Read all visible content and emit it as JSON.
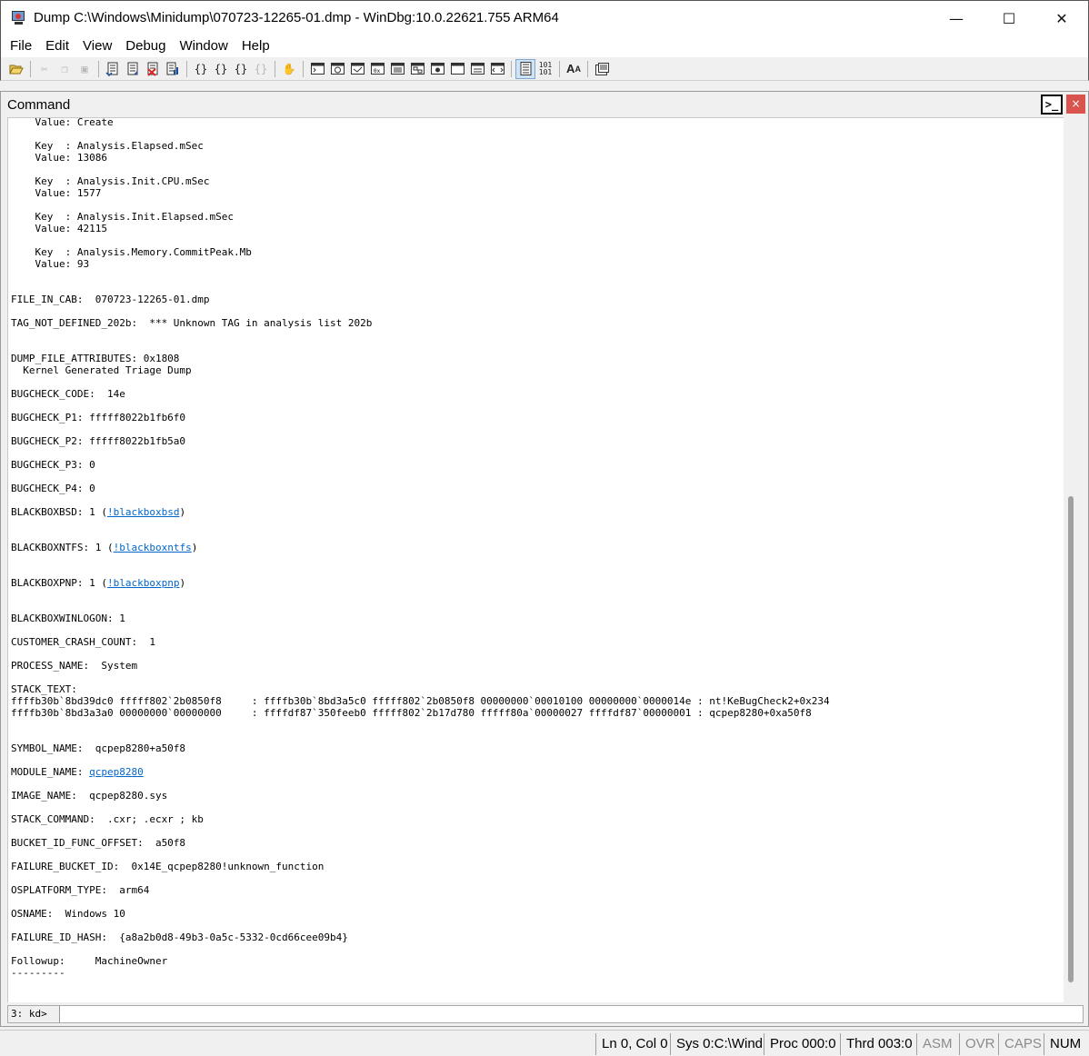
{
  "window": {
    "title": "Dump C:\\Windows\\Minidump\\070723-12265-01.dmp - WinDbg:10.0.22621.755 ARM64",
    "minimize": "—",
    "maximize": "☐",
    "close": "✕"
  },
  "menu": {
    "items": [
      "File",
      "Edit",
      "View",
      "Debug",
      "Window",
      "Help"
    ]
  },
  "toolbar": {
    "icons": [
      "open-icon",
      "cut-icon",
      "copy-icon",
      "paste-icon",
      "go-icon",
      "restart-icon",
      "stop-debugging-icon",
      "break-icon",
      "step-into-icon",
      "step-over-icon",
      "step-out-icon",
      "run-to-cursor-icon",
      "insert-breakpoint-icon",
      "command-icon",
      "watch-icon",
      "locals-icon",
      "registers-icon",
      "memory-icon",
      "call-stack-icon",
      "disassembly-icon",
      "scratch-pad-icon",
      "processes-icon",
      "source-mode-icon",
      "hex-icon",
      "font-icon",
      "options-icon"
    ]
  },
  "command_window": {
    "title": "Command",
    "close_glyph": "×",
    "console_glyph": ">_",
    "output": {
      "l1": "    Value: Create",
      "l2": "",
      "l3": "    Key  : Analysis.Elapsed.mSec",
      "l4": "    Value: 13086",
      "l5": "",
      "l6": "    Key  : Analysis.Init.CPU.mSec",
      "l7": "    Value: 1577",
      "l8": "",
      "l9": "    Key  : Analysis.Init.Elapsed.mSec",
      "l10": "    Value: 42115",
      "l11": "",
      "l12": "    Key  : Analysis.Memory.CommitPeak.Mb",
      "l13": "    Value: 93",
      "l14": "",
      "l15": "",
      "l16": "FILE_IN_CAB:  070723-12265-01.dmp",
      "l17": "",
      "l18": "TAG_NOT_DEFINED_202b:  *** Unknown TAG in analysis list 202b",
      "l19": "",
      "l20": "",
      "l21": "DUMP_FILE_ATTRIBUTES: 0x1808",
      "l22": "  Kernel Generated Triage Dump",
      "l23": "",
      "l24": "BUGCHECK_CODE:  14e",
      "l25": "",
      "l26": "BUGCHECK_P1: fffff8022b1fb6f0",
      "l27": "",
      "l28": "BUGCHECK_P2: fffff8022b1fb5a0",
      "l29": "",
      "l30": "BUGCHECK_P3: 0",
      "l31": "",
      "l32": "BUGCHECK_P4: 0",
      "l33": "",
      "l34_pre": "BLACKBOXBSD: 1 (",
      "l34_link": "!blackboxbsd",
      "l34_post": ")",
      "l35": "",
      "l36": "",
      "l37_pre": "BLACKBOXNTFS: 1 (",
      "l37_link": "!blackboxntfs",
      "l37_post": ")",
      "l38": "",
      "l39": "",
      "l40_pre": "BLACKBOXPNP: 1 (",
      "l40_link": "!blackboxpnp",
      "l40_post": ")",
      "l41": "",
      "l42": "",
      "l43": "BLACKBOXWINLOGON: 1",
      "l44": "",
      "l45": "CUSTOMER_CRASH_COUNT:  1",
      "l46": "",
      "l47": "PROCESS_NAME:  System",
      "l48": "",
      "l49": "STACK_TEXT:",
      "l50": "ffffb30b`8bd39dc0 fffff802`2b0850f8     : ffffb30b`8bd3a5c0 fffff802`2b0850f8 00000000`00010100 00000000`0000014e : nt!KeBugCheck2+0x234",
      "l51": "ffffb30b`8bd3a3a0 00000000`00000000     : ffffdf87`350feeb0 fffff802`2b17d780 fffff80a`00000027 ffffdf87`00000001 : qcpep8280+0xa50f8",
      "l52": "",
      "l53": "",
      "l54": "SYMBOL_NAME:  qcpep8280+a50f8",
      "l55": "",
      "l56_pre": "MODULE_NAME: ",
      "l56_link": "qcpep8280",
      "l57": "",
      "l58": "IMAGE_NAME:  qcpep8280.sys",
      "l59": "",
      "l60": "STACK_COMMAND:  .cxr; .ecxr ; kb",
      "l61": "",
      "l62": "BUCKET_ID_FUNC_OFFSET:  a50f8",
      "l63": "",
      "l64": "FAILURE_BUCKET_ID:  0x14E_qcpep8280!unknown_function",
      "l65": "",
      "l66": "OSPLATFORM_TYPE:  arm64",
      "l67": "",
      "l68": "OSNAME:  Windows 10",
      "l69": "",
      "l70": "FAILURE_ID_HASH:  {a8a2b0d8-49b3-0a5c-5332-0cd66cee09b4}",
      "l71": "",
      "l72": "Followup:     MachineOwner",
      "l73": "---------"
    },
    "prompt": "3: kd>",
    "input_value": ""
  },
  "statusbar": {
    "ln_col": "Ln 0, Col 0",
    "sys": "Sys 0:C:\\Wind",
    "proc": "Proc 000:0",
    "thrd": "Thrd 003:0",
    "asm": "ASM",
    "ovr": "OVR",
    "caps": "CAPS",
    "num": "NUM"
  }
}
